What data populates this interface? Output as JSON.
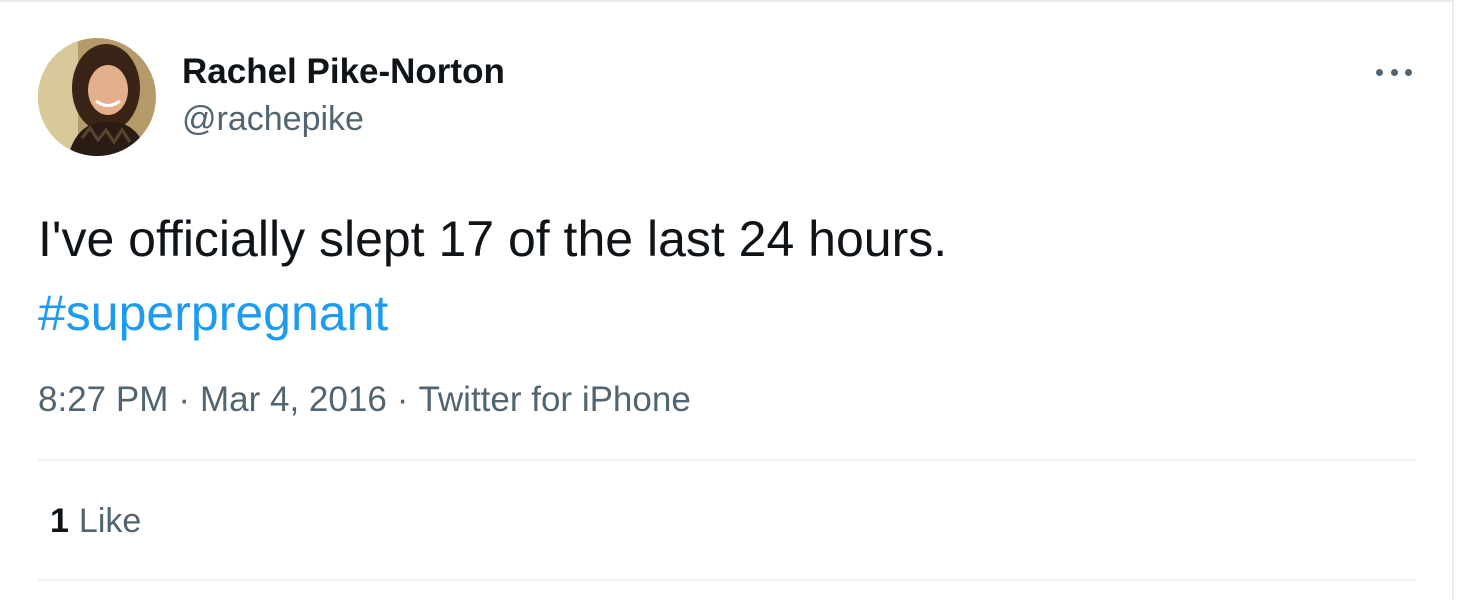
{
  "tweet": {
    "author": {
      "display_name": "Rachel Pike-Norton",
      "handle": "@rachepike"
    },
    "text_line1": "I've officially slept 17 of the last 24 hours.",
    "hashtag": "#superpregnant",
    "time": "8:27 PM",
    "date": "Mar 4, 2016",
    "source": "Twitter for iPhone",
    "separator": "·",
    "likes": {
      "count": "1",
      "label": "Like"
    },
    "more_menu_icon": "more-horizontal-icon"
  },
  "colors": {
    "text_primary": "#0f1419",
    "text_secondary": "#536471",
    "link": "#1d9bf0",
    "divider": "#eff3f4"
  }
}
